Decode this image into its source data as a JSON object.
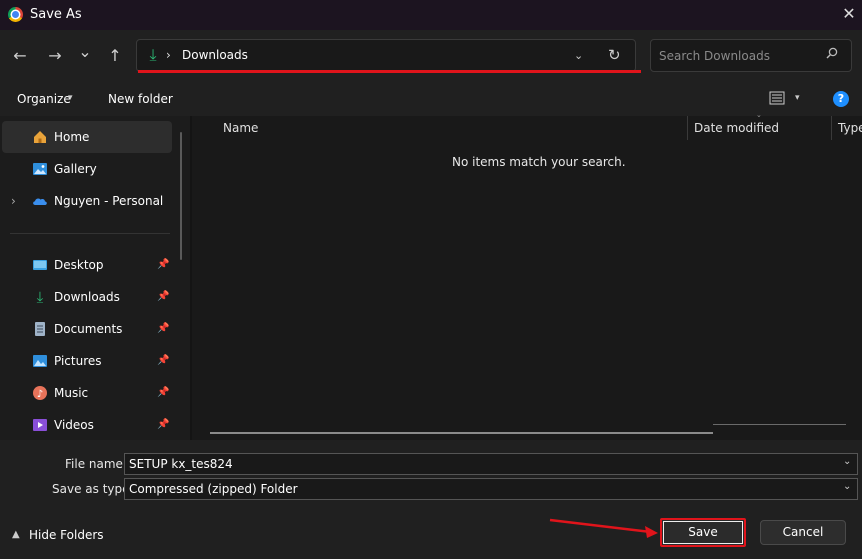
{
  "window": {
    "title": "Save As",
    "close_glyph": "✕"
  },
  "nav": {
    "back_glyph": "←",
    "forward_glyph": "→",
    "recent_glyph": "⌄",
    "up_glyph": "↑",
    "address": {
      "chevron": "›",
      "current": "Downloads",
      "dropdown_glyph": "⌄",
      "refresh_glyph": "↻"
    },
    "search": {
      "placeholder": "Search Downloads",
      "icon": "search-icon"
    }
  },
  "toolbar": {
    "organize_label": "Organize",
    "new_folder_label": "New folder",
    "caret": "▾",
    "view_icon": "view-details-icon",
    "help_label": "?"
  },
  "sidebar": {
    "expand_glyph": "›",
    "pin_glyph": "📌",
    "items": [
      {
        "label": "Home",
        "icon": "home-icon",
        "selected": true
      },
      {
        "label": "Gallery",
        "icon": "gallery-icon"
      },
      {
        "label": "Nguyen - Personal",
        "icon": "onedrive-cloud-icon",
        "expandable": true
      },
      {
        "label": "Desktop",
        "icon": "desktop-icon",
        "pinned": true
      },
      {
        "label": "Downloads",
        "icon": "download-icon",
        "pinned": true
      },
      {
        "label": "Documents",
        "icon": "documents-icon",
        "pinned": true
      },
      {
        "label": "Pictures",
        "icon": "pictures-icon",
        "pinned": true
      },
      {
        "label": "Music",
        "icon": "music-icon",
        "pinned": true
      },
      {
        "label": "Videos",
        "icon": "videos-icon",
        "pinned": true
      }
    ]
  },
  "content": {
    "columns": [
      "Name",
      "Date modified",
      "Type"
    ],
    "empty_message": "No items match your search."
  },
  "form": {
    "file_name_label": "File name:",
    "file_name_value": "SETUP kx_tes824",
    "save_type_label": "Save as type:",
    "save_type_value": "Compressed (zipped) Folder",
    "dropdown_glyph": "⌄"
  },
  "footer": {
    "hide_folders_label": "Hide Folders",
    "hide_caret": "▲",
    "save_label": "Save",
    "cancel_label": "Cancel"
  },
  "colors": {
    "highlight_red": "#e0141b",
    "accent_green": "#2bb673",
    "accent_blue": "#1e8fff"
  }
}
